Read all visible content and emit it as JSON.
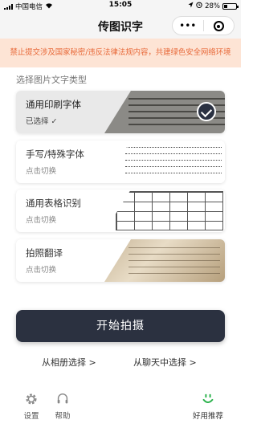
{
  "status_bar": {
    "carrier": "中国电信",
    "time": "15:05",
    "battery_percent": "28%",
    "battery_level": 0.28
  },
  "nav": {
    "title": "传图识字",
    "more_label": "•••"
  },
  "warning": {
    "text": "禁止提交涉及国家秘密/违反法律法规内容，共建绿色安全网络环境",
    "color": "#e86a3a",
    "background": "#fde4d5"
  },
  "section_label": "选择图片文字类型",
  "types": [
    {
      "name": "通用印刷字体",
      "sub": "已选择 ✓",
      "selected": true
    },
    {
      "name": "手写/特殊字体",
      "sub": "点击切换",
      "selected": false
    },
    {
      "name": "通用表格识别",
      "sub": "点击切换",
      "selected": false
    },
    {
      "name": "拍照翻译",
      "sub": "点击切换",
      "selected": false
    }
  ],
  "start_button": "开始拍摄",
  "links": {
    "album": "从相册选择 >",
    "chat": "从聊天中选择 >"
  },
  "tabs": [
    {
      "label": "设置",
      "icon": "gear-icon"
    },
    {
      "label": "帮助",
      "icon": "headset-icon"
    },
    {
      "label": "好用推荐",
      "icon": "smile-icon",
      "accent": "#2bb24c"
    }
  ],
  "accent_color": "#2b3140"
}
